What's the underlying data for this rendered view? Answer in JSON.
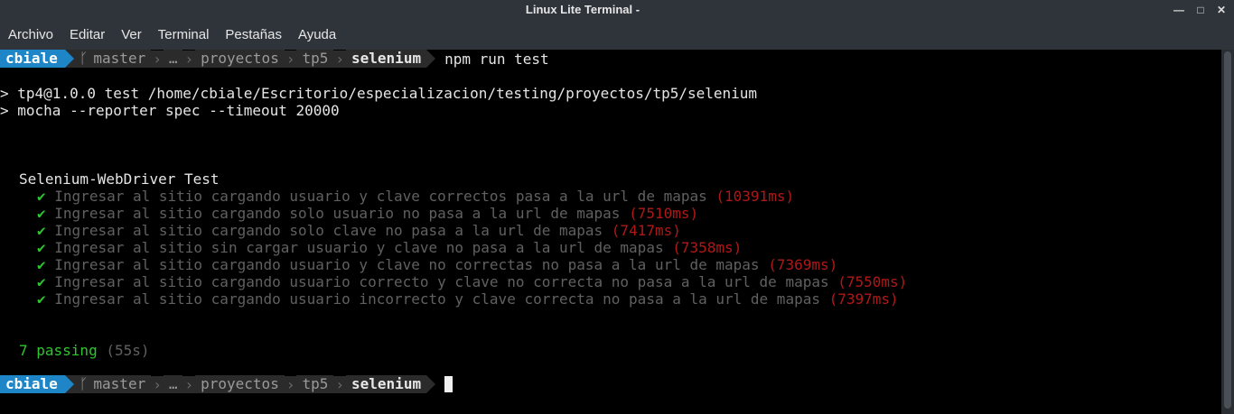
{
  "window": {
    "title": "Linux Lite Terminal -",
    "minimize_glyph": "—",
    "maximize_glyph": "□",
    "close_glyph": "✕"
  },
  "menu": [
    {
      "label": "Archivo"
    },
    {
      "label": "Editar"
    },
    {
      "label": "Ver"
    },
    {
      "label": "Terminal"
    },
    {
      "label": "Pestañas"
    },
    {
      "label": "Ayuda"
    }
  ],
  "prompt": {
    "user": "cbiale",
    "branch_icon": "ᚴ",
    "branch": "master",
    "ellipsis": "…",
    "dirs": [
      "proyectos",
      "tp5"
    ],
    "current": "selenium",
    "separator": "›"
  },
  "command": "npm run test",
  "output": {
    "line1": "> tp4@1.0.0 test /home/cbiale/Escritorio/especializacion/testing/proyectos/tp5/selenium",
    "line2": "> mocha --reporter spec --timeout 20000",
    "suite": "Selenium-WebDriver Test",
    "check": "✔",
    "tests": [
      {
        "text": "Ingresar al sitio cargando usuario y clave correctos pasa a la url de mapas",
        "duration": "(10391ms)"
      },
      {
        "text": "Ingresar al sitio cargando solo usuario no pasa a la url de mapas",
        "duration": "(7510ms)"
      },
      {
        "text": "Ingresar al sitio cargando solo clave no pasa a la url de mapas",
        "duration": "(7417ms)"
      },
      {
        "text": "Ingresar al sitio sin cargar usuario y clave no pasa a la url de mapas",
        "duration": "(7358ms)"
      },
      {
        "text": "Ingresar al sitio cargando usuario y clave no correctas no pasa a la url de mapas",
        "duration": "(7369ms)"
      },
      {
        "text": "Ingresar al sitio cargando usuario correcto y clave no correcta no pasa a la url de mapas",
        "duration": "(7550ms)"
      },
      {
        "text": "Ingresar al sitio cargando usuario incorrecto y clave correcta no pasa a la url de mapas",
        "duration": "(7397ms)"
      }
    ],
    "passing": "7 passing",
    "passing_time": "(55s)"
  },
  "colors": {
    "prompt_user_bg": "#1e86c7",
    "pass": "#2ec62e",
    "duration": "#b01818",
    "muted": "#606060"
  }
}
